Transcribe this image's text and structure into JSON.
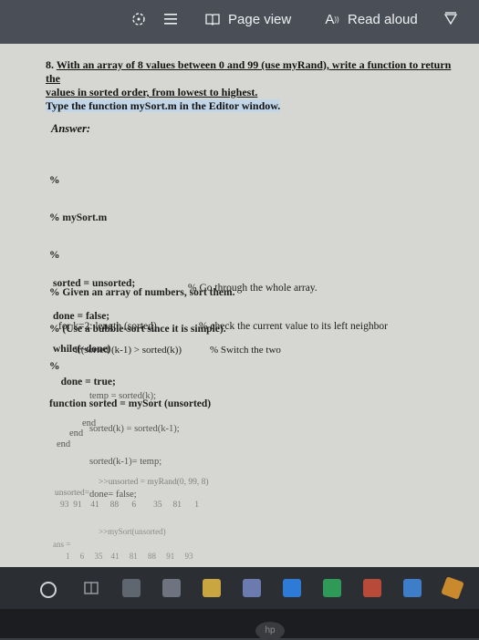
{
  "toolbar": {
    "page_view_label": "Page view",
    "read_aloud_label": "Read aloud",
    "read_aloud_icon_text": "A"
  },
  "question": {
    "number": "8.",
    "line1": "With an array of 8 values between 0 and 99 (use myRand), write a function to return the",
    "line2": "values in sorted order, from lowest to highest.",
    "line3": "Type the function mySort.m in the Editor window."
  },
  "answer_label": "Answer:",
  "code": {
    "header": [
      "%",
      "% mySort.m",
      "%",
      "% Given an array of numbers, sort them.",
      "% (Use a bubble-sort since it is simple).",
      "%",
      "function sorted = mySort (unsorted)"
    ],
    "init": [
      "sorted = unsorted;",
      "done = false;",
      "while(~done)",
      "   done = true;"
    ],
    "while_comment": "% Go through the whole array.",
    "for_line": "for k=2: length (sorted)",
    "for_comment": "% check the current value to its left neighbor",
    "if_line": "if(sorted (k-1) > sorted(k))",
    "if_comment": "% Switch the two",
    "swap": [
      "temp = sorted(k);",
      "sorted(k) = sorted(k-1);",
      "sorted(k-1)= temp;",
      "done= false;"
    ],
    "ends": [
      "end",
      "end",
      "end"
    ],
    "cmd1": ">>unsorted = myRand(0, 99, 8)",
    "out1_label": "unsorted=",
    "out1_values": "93  91    41     88      6        35     81      1",
    "cmd2": ">>mySort(unsorted)",
    "out2_label": "ans =",
    "out2_values": "1     6     35    41     81     88     91     93"
  },
  "bezel_logo": "hp"
}
